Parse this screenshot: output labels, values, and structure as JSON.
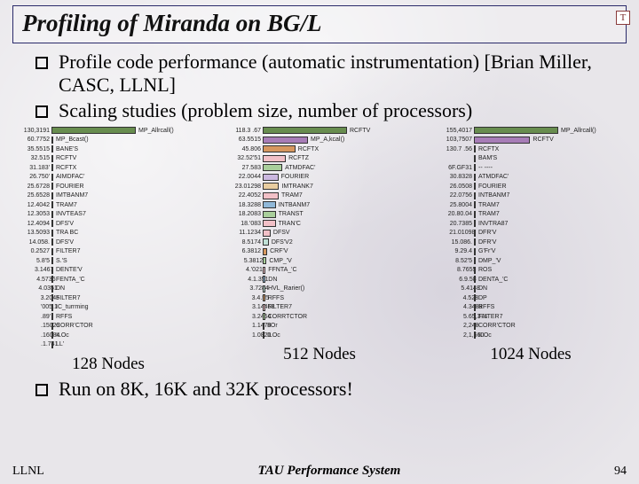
{
  "title": "Profiling of Miranda on BG/L",
  "logo_char": "T",
  "bullets": [
    "Profile code performance (automatic instrumentation) [Brian Miller, CASC, LLNL]",
    "Scaling studies (problem size, number of processors)"
  ],
  "bullet_run": "Run on 8K, 16K and 32K processors!",
  "footer": {
    "left": "LLNL",
    "center": "TAU Performance System",
    "right": "94"
  },
  "chart_data": [
    {
      "type": "bar",
      "caption": "128 Nodes",
      "label_col_w": 52,
      "max_bar_w": 95,
      "series": [
        {
          "value": "130,3191",
          "label": "MP_Allrcall()",
          "color": "#688d4f"
        },
        {
          "value": "60.7752",
          "label": "MP_Bcast()",
          "color": "#a77db7"
        },
        {
          "value": "35.5515",
          "label": "BANE'S",
          "color": "#d6975f"
        },
        {
          "value": "32.515",
          "label": "RCFTV",
          "color": "#f2c0c7"
        },
        {
          "value": "31.183'",
          "label": "RCFTX",
          "color": "#90b8d8"
        },
        {
          "value": "26.750'",
          "label": "AIMDFAC'",
          "color": "#a9cf9b"
        },
        {
          "value": "25.6728",
          "label": "FOURIER",
          "color": "#cbb7e0"
        },
        {
          "value": "25.6528",
          "label": "IMTBANM7",
          "color": "#e8cda0"
        },
        {
          "value": "12.4042",
          "label": "TRAM7",
          "color": "#f2c0c7"
        },
        {
          "value": "12.3053",
          "label": "INVTEAS7",
          "color": "#90b8d8"
        },
        {
          "value": "12.4094",
          "label": "DFS'V",
          "color": "#a9cf9b"
        },
        {
          "value": "13.5093",
          "label": "TRA BC",
          "color": "#f2c0c7"
        },
        {
          "value": "14.058.",
          "label": "DFS'V",
          "color": "#f2c0c7"
        },
        {
          "value": "0.2527",
          "label": "FILTER7",
          "color": "#c0e0d6"
        },
        {
          "value": "5.8'5",
          "label": "S.'S",
          "color": "#d6975f"
        },
        {
          "value": "3.1467",
          "label": "DENTE'V",
          "color": "#a9cf9b"
        },
        {
          "value": "4.5736",
          "label": "FENTA_'C",
          "color": "#f2c0c7"
        },
        {
          "value": "4.0351",
          "label": "DN",
          "color": "#90b8d8"
        },
        {
          "value": "3.2045",
          "label": "FILTER7",
          "color": "#c0e0d6"
        },
        {
          "value": "'005.1",
          "label": "IC_turrming",
          "color": "#d6975f"
        },
        {
          "value": ".89'",
          "label": "RFFS",
          "color": "#f2c0c7"
        },
        {
          "value": ".15029",
          "label": "CORR'CTOR",
          "color": "#a9cf9b"
        },
        {
          "value": ".16084",
          "label": "ILOc",
          "color": "#999"
        },
        {
          "value": ".1.741",
          "label": "LL'",
          "color": "#777"
        }
      ]
    },
    {
      "type": "bar",
      "caption": "512 Nodes",
      "label_col_w": 52,
      "max_bar_w": 95,
      "series": [
        {
          "value": "118.3 .67",
          "label": "RCFTV",
          "color": "#688d4f"
        },
        {
          "value": "63.5515",
          "label": "MP_A,kcal()",
          "color": "#a77db7"
        },
        {
          "value": "45.806",
          "label": "RCFTX",
          "color": "#d6975f"
        },
        {
          "value": "32.52'51",
          "label": "RCFTZ",
          "color": "#f2c0c7"
        },
        {
          "value": "27.583",
          "label": "ATMDFAC'",
          "color": "#a9cf9b"
        },
        {
          "value": "22.0044",
          "label": "FOURIER",
          "color": "#cbb7e0"
        },
        {
          "value": "23.01298",
          "label": "IMTRANK7",
          "color": "#e8cda0"
        },
        {
          "value": "22.4052",
          "label": "TRAM7",
          "color": "#f2c0c7"
        },
        {
          "value": "18.3288",
          "label": "INTBANM7",
          "color": "#90b8d8"
        },
        {
          "value": "18.2083",
          "label": "TRANST",
          "color": "#a9cf9b"
        },
        {
          "value": "18.'083",
          "label": "TRAN'C",
          "color": "#f2c0c7"
        },
        {
          "value": "11.1234",
          "label": "DFSV",
          "color": "#f2c0c7"
        },
        {
          "value": "8.5174",
          "label": "DFS'V2",
          "color": "#c0e0d6"
        },
        {
          "value": "6.3812",
          "label": "CRF'V",
          "color": "#d6975f"
        },
        {
          "value": "5.3812",
          "label": "CMP_'V",
          "color": "#a9cf9b"
        },
        {
          "value": "4.'021",
          "label": "FFNTA_'C",
          "color": "#f2c0c7"
        },
        {
          "value": "4.1.351",
          "label": "DN",
          "color": "#90b8d8"
        },
        {
          "value": "3.7284",
          "label": "HVL_Rarier()",
          "color": "#c0e0d6"
        },
        {
          "value": "3.4.55",
          "label": "RFFS",
          "color": "#d6975f"
        },
        {
          "value": "3.14468",
          "label": "FILTER7",
          "color": "#f2c0c7"
        },
        {
          "value": "3.2454",
          "label": "CORRTCTOR",
          "color": "#a9cf9b"
        },
        {
          "value": "1.1478",
          "label": "IIOr",
          "color": "#999"
        },
        {
          "value": "1.0820",
          "label": "ILOc",
          "color": "#777"
        }
      ]
    },
    {
      "type": "bar",
      "caption": "1024 Nodes",
      "label_col_w": 52,
      "max_bar_w": 95,
      "series": [
        {
          "value": "155,4017",
          "label": "MP_Allrcall()",
          "color": "#688d4f"
        },
        {
          "value": "103,7507",
          "label": "RCFTV",
          "color": "#a77db7"
        },
        {
          "value": "130.7 .56",
          "label": "RCFTX",
          "color": "#d6975f"
        },
        {
          "value": "",
          "label": "BAM'S",
          "color": "#f2c0c7"
        },
        {
          "value": "6F.GF31",
          "label": "-- ----",
          "color": "#90b8d8"
        },
        {
          "value": "30.8328",
          "label": "ATMDFAC'",
          "color": "#a9cf9b"
        },
        {
          "value": "26.0508",
          "label": "FOURIER",
          "color": "#cbb7e0"
        },
        {
          "value": "22.0756",
          "label": "INTBANM7",
          "color": "#e8cda0"
        },
        {
          "value": "25.8004",
          "label": "TRAM7",
          "color": "#f2c0c7"
        },
        {
          "value": "20.80.04",
          "label": "TRAM7",
          "color": "#90b8d8"
        },
        {
          "value": "20.7385",
          "label": "INVTRA87",
          "color": "#a9cf9b"
        },
        {
          "value": "21.01098",
          "label": "DFR'V",
          "color": "#f2c0c7"
        },
        {
          "value": "15.086.",
          "label": "DFR'V",
          "color": "#c0e0d6"
        },
        {
          "value": "9.29.4",
          "label": "G'Fr'V",
          "color": "#d6975f"
        },
        {
          "value": "8.52'5",
          "label": "DMP_'V",
          "color": "#a9cf9b"
        },
        {
          "value": "8.7655",
          "label": "ROS",
          "color": "#f2c0c7"
        },
        {
          "value": "6.9.58",
          "label": "DENTA_'C",
          "color": "#90b8d8"
        },
        {
          "value": "5.4148",
          "label": "DN",
          "color": "#c0e0d6"
        },
        {
          "value": "4.528",
          "label": "DP",
          "color": "#d6975f"
        },
        {
          "value": "4.3488",
          "label": "RFFS",
          "color": "#f2c0c7"
        },
        {
          "value": "5.65,374",
          "label": "FILTER7",
          "color": "#a9cf9b"
        },
        {
          "value": "2,248",
          "label": "CORR'CTOR",
          "color": "#999"
        },
        {
          "value": "2,1,560",
          "label": "ILOc",
          "color": "#777"
        }
      ]
    }
  ]
}
